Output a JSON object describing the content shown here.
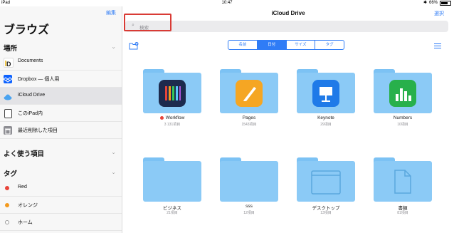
{
  "status_bar": {
    "left": "iPad",
    "time": "10:47",
    "battery": "66%"
  },
  "sidebar": {
    "edit_label": "編集",
    "title": "ブラウズ",
    "locations_header": "場所",
    "locations": [
      {
        "label": "Documents",
        "icon": "documents-app-icon"
      },
      {
        "label": "Dropbox — 個人用",
        "icon": "dropbox-icon"
      },
      {
        "label": "iCloud Drive",
        "icon": "icloud-icon",
        "selected": true
      },
      {
        "label": "このiPad内",
        "icon": "ipad-icon"
      },
      {
        "label": "最近削除した項目",
        "icon": "trash-icon"
      }
    ],
    "favorites_header": "よく使う項目",
    "tags_header": "タグ",
    "tags": [
      {
        "label": "Red",
        "color": "#e8443a"
      },
      {
        "label": "オレンジ",
        "color": "#f39a1e"
      },
      {
        "label": "ホーム",
        "color": "#ffffff"
      }
    ]
  },
  "main": {
    "title": "iCloud Drive",
    "select_label": "選択",
    "search_placeholder": "検索",
    "sort_options": [
      "名前",
      "日付",
      "サイズ",
      "タグ"
    ],
    "sort_selected": "日付",
    "folders": [
      {
        "name": "Workflow",
        "subtitle": "3 131項目",
        "app": "workflow",
        "tag_color": "#e8443a"
      },
      {
        "name": "Pages",
        "subtitle": "1543項目",
        "app": "pages"
      },
      {
        "name": "Keynote",
        "subtitle": "29項目",
        "app": "keynote"
      },
      {
        "name": "Numbers",
        "subtitle": "10項目",
        "app": "numbers"
      },
      {
        "name": "ビジネス",
        "subtitle": "21項目"
      },
      {
        "name": "sss",
        "subtitle": "12項目"
      },
      {
        "name": "デスクトップ",
        "subtitle": "13項目",
        "app": "desktop"
      },
      {
        "name": "書類",
        "subtitle": "81項目",
        "app": "document"
      }
    ]
  },
  "colors": {
    "accent": "#2f7cf6",
    "folder": "#8bcaf6",
    "highlight_box": "#d93b35"
  }
}
